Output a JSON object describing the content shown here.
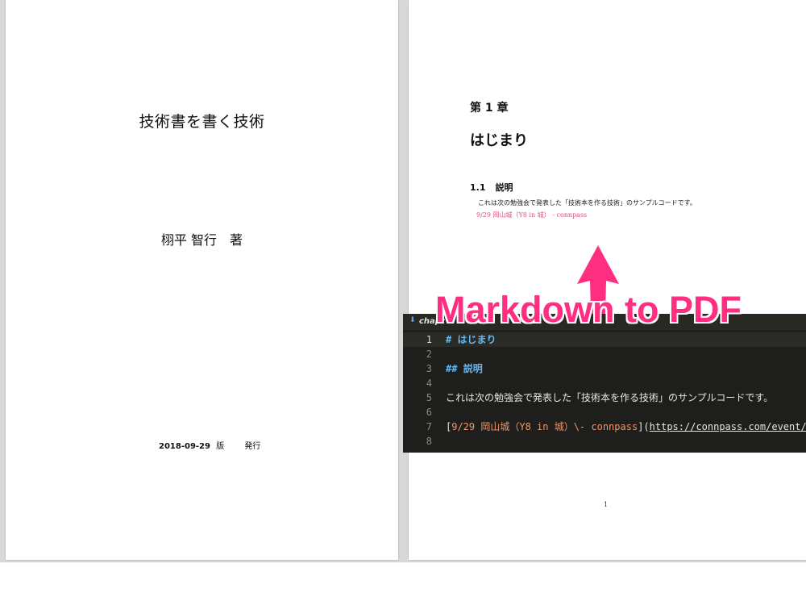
{
  "cover_page": {
    "title": "技術書を書く技術",
    "author": "栩平 智行　著",
    "date": "2018-09-29",
    "edition_label": "版",
    "publish_label": "発行"
  },
  "content_page": {
    "chapter_number": "第 1 章",
    "chapter_title": "はじまり",
    "section_number": "1.1",
    "section_title": "説明",
    "body_text": "これは次の勉強会で発表した「技術本を作る技術」のサンプルコードです。",
    "link_text": "9/29 岡山城（Y8 in 城） - connpass",
    "page_number": "1"
  },
  "overlay": {
    "label": "Markdown to PDF",
    "color": "#ff2e80"
  },
  "editor": {
    "tab_icon": "markdown-file-icon",
    "tab_name": "chapt",
    "lines": [
      {
        "no": "1",
        "marker": "#",
        "text": "はじまり"
      },
      {
        "no": "2"
      },
      {
        "no": "3",
        "marker": "##",
        "text": "説明"
      },
      {
        "no": "4"
      },
      {
        "no": "5",
        "text": "これは次の勉強会で発表した「技術本を作る技術」のサンプルコードです。"
      },
      {
        "no": "6"
      },
      {
        "no": "7",
        "link_open": "[",
        "link_text": "9/29 岡山城（Y8 in 城）\\- connpass",
        "link_close": "](",
        "url": "https://connpass.com/event/98976/",
        "end": ")"
      },
      {
        "no": "8"
      }
    ]
  }
}
